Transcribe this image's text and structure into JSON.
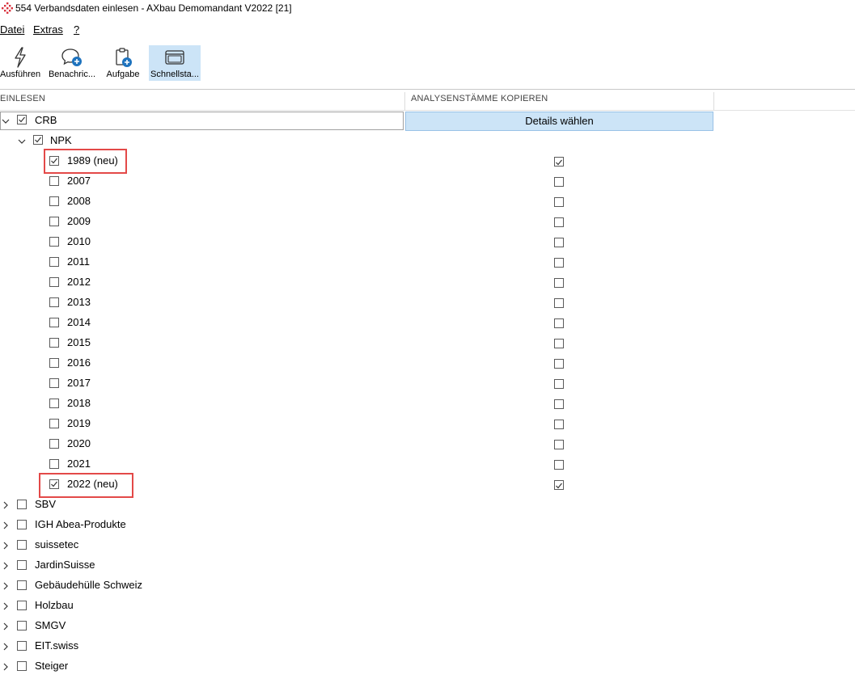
{
  "window": {
    "title": "554 Verbandsdaten einlesen - AXbau Demomandant V2022 [21]"
  },
  "menu": [
    {
      "label": "Datei"
    },
    {
      "label": "Extras"
    },
    {
      "label": "?"
    }
  ],
  "toolbar": {
    "buttons": [
      {
        "label": "Ausführen",
        "icon": "lightning-icon"
      },
      {
        "label": "Benachric...",
        "icon": "message-add-icon"
      },
      {
        "label": "Aufgabe",
        "icon": "clipboard-add-icon"
      },
      {
        "label": "Schnellsta...",
        "icon": "windows-icon",
        "active": true
      }
    ]
  },
  "grid": {
    "columns": [
      "EINLESEN",
      "ANALYSENSTÄMME KOPIEREN"
    ],
    "details_button": "Details wählen",
    "root": {
      "label": "CRB",
      "checked": true,
      "expanded": true
    },
    "child": {
      "label": "NPK",
      "checked": true,
      "expanded": true
    },
    "years": [
      {
        "label": "1989 (neu)",
        "checked": true,
        "analysis": true,
        "highlighted": true
      },
      {
        "label": "2007",
        "checked": false,
        "analysis": false
      },
      {
        "label": "2008",
        "checked": false,
        "analysis": false
      },
      {
        "label": "2009",
        "checked": false,
        "analysis": false
      },
      {
        "label": "2010",
        "checked": false,
        "analysis": false
      },
      {
        "label": "2011",
        "checked": false,
        "analysis": false
      },
      {
        "label": "2012",
        "checked": false,
        "analysis": false
      },
      {
        "label": "2013",
        "checked": false,
        "analysis": false
      },
      {
        "label": "2014",
        "checked": false,
        "analysis": false
      },
      {
        "label": "2015",
        "checked": false,
        "analysis": false
      },
      {
        "label": "2016",
        "checked": false,
        "analysis": false
      },
      {
        "label": "2017",
        "checked": false,
        "analysis": false
      },
      {
        "label": "2018",
        "checked": false,
        "analysis": false
      },
      {
        "label": "2019",
        "checked": false,
        "analysis": false
      },
      {
        "label": "2020",
        "checked": false,
        "analysis": false
      },
      {
        "label": "2021",
        "checked": false,
        "analysis": false
      },
      {
        "label": "2022 (neu)",
        "checked": true,
        "analysis": true,
        "highlighted": true
      }
    ],
    "other_groups": [
      {
        "label": "SBV",
        "checked": false
      },
      {
        "label": "IGH Abea-Produkte",
        "checked": false
      },
      {
        "label": "suissetec",
        "checked": false
      },
      {
        "label": "JardinSuisse",
        "checked": false
      },
      {
        "label": "Gebäudehülle Schweiz",
        "checked": false
      },
      {
        "label": "Holzbau",
        "checked": false
      },
      {
        "label": "SMGV",
        "checked": false
      },
      {
        "label": "EIT.swiss",
        "checked": false
      },
      {
        "label": "Steiger",
        "checked": false
      }
    ]
  },
  "colors": {
    "accent": "#cce4f7",
    "highlight": "#e34948",
    "icon_blue": "#1e73be"
  }
}
